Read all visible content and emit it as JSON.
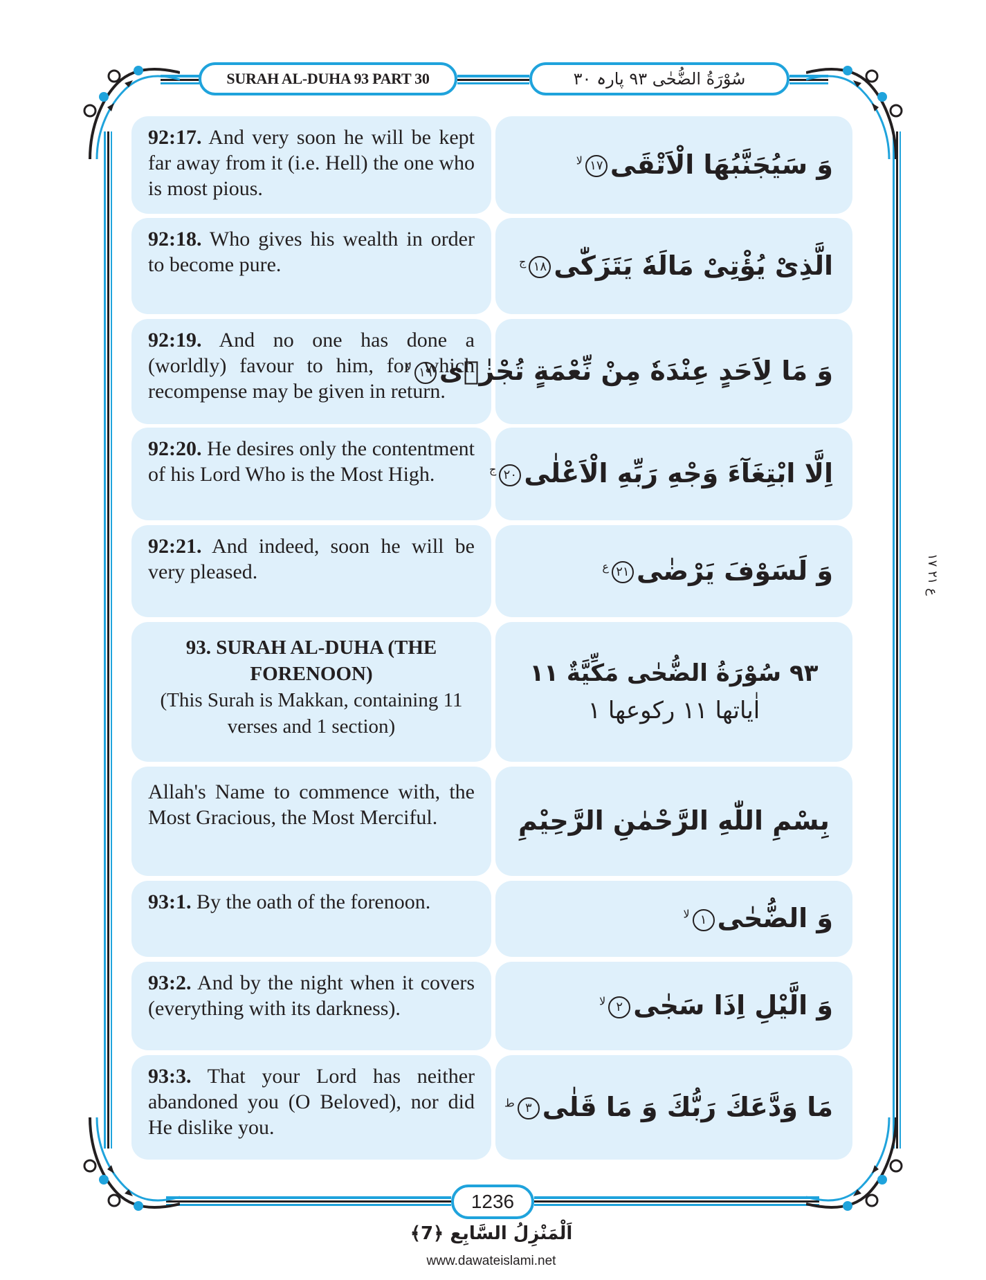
{
  "header": {
    "left_title": "SURAH AL-DUHA 93 PART 30",
    "right_title": "سُوْرَةُ الضُّحٰى ۹۳ پارہ ۳۰"
  },
  "rows": [
    {
      "ref": "92:17.",
      "en": "And very soon he will be kept far away from it (i.e. Hell) the one who is most pious.",
      "ar": "وَ سَيُجَنَّبُهَا الْاَتْقَى",
      "ayah_no": "١٧",
      "stop_mark": "لا"
    },
    {
      "ref": "92:18.",
      "en": "Who gives his wealth in order to become pure.",
      "ar": "الَّذِیْ یُؤْتِیْ مَالَهٗ یَتَزَكّٰى",
      "ayah_no": "١٨",
      "stop_mark": "ج"
    },
    {
      "ref": "92:19.",
      "en": "And no one has done a (worldly) favour to him, for which recompense may be given in return.",
      "ar": "وَ مَا لِاَحَدٍ عِنْدَهٗ مِنْ نِّعْمَةٍ تُجْزٰۤى",
      "ayah_no": "١٩",
      "stop_mark": "لا"
    },
    {
      "ref": "92:20.",
      "en": "He desires only the contentment of his Lord Who is the Most High.",
      "ar": "اِلَّا ابْتِغَآءَ وَجْهِ رَبِّهِ الْاَعْلٰى",
      "ayah_no": "٢٠",
      "stop_mark": "ج"
    },
    {
      "ref": "92:21.",
      "en": "And indeed, soon he will be very pleased.",
      "ar": "وَ لَسَوْفَ یَرْضٰى",
      "ayah_no": "٢١",
      "stop_mark": "ع"
    }
  ],
  "surah_intro": {
    "title": "93. SURAH AL-DUHA (THE FORENOON)",
    "info": "(This Surah is Makkan, containing 11 verses and 1 section)",
    "ar_line1": "۹۳ سُوْرَةُ الضُّحٰى مَكِّيَّةٌ ۱۱",
    "ar_line2": "اٰیاتها ۱۱ ركوعها ۱"
  },
  "bismillah": {
    "en": "Allah's Name to commence with, the Most Gracious, the Most Merciful.",
    "ar": "بِسْمِ اللّٰهِ الرَّحْمٰنِ الرَّحِیْمِ"
  },
  "rows2": [
    {
      "ref": "93:1.",
      "en": "By the oath of the forenoon.",
      "ar": "وَ الضُّحٰى",
      "ayah_no": "١",
      "stop_mark": "لا"
    },
    {
      "ref": "93:2.",
      "en": "And by the night when it covers (everything with its darkness).",
      "ar": "وَ الَّیْلِ اِذَا سَجٰى",
      "ayah_no": "٢",
      "stop_mark": "لا"
    },
    {
      "ref": "93:3.",
      "en": "That your Lord has neither abandoned you (O Beloved), nor did He dislike you.",
      "ar": "مَا وَدَّعَكَ رَبُّكَ وَ مَا قَلٰى",
      "ayah_no": "٣",
      "stop_mark": "ط"
    }
  ],
  "side_marker": "ع ۲۱ ۱۷",
  "footer": {
    "page_number": "1236",
    "manzil": "اَلْمَنْزِلُ السَّابِع ﴿7﴾",
    "url": "www.dawateislami.net"
  },
  "colors": {
    "accent_blue": "#1fa3dc",
    "cell_bg": "#dff0fb",
    "text": "#231f20"
  }
}
